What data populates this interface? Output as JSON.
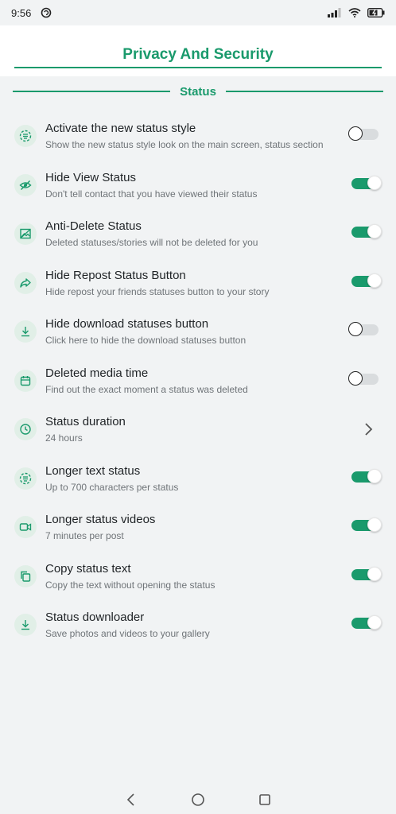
{
  "status_bar": {
    "time": "9:56",
    "battery_level": "charging"
  },
  "header": {
    "title": "Privacy And Security"
  },
  "section": {
    "label": "Status"
  },
  "colors": {
    "accent": "#1a9a6c",
    "icon_bg": "#e1efe7",
    "background": "#f1f3f4"
  },
  "items": [
    {
      "title": "Activate the new status style",
      "subtitle": "Show the new status style look on the main screen, status section",
      "icon": "status-style-icon",
      "control": "toggle",
      "on": false
    },
    {
      "title": "Hide View Status",
      "subtitle": "Don't tell contact that you have viewed their status",
      "icon": "eye-off-icon",
      "control": "toggle",
      "on": true
    },
    {
      "title": "Anti-Delete Status",
      "subtitle": "Deleted statuses/stories will not be deleted for you",
      "icon": "image-icon",
      "control": "toggle",
      "on": true
    },
    {
      "title": "Hide Repost Status Button",
      "subtitle": "Hide repost your friends statuses button to your story",
      "icon": "share-icon",
      "control": "toggle",
      "on": true
    },
    {
      "title": "Hide download statuses button",
      "subtitle": "Click here to hide the download statuses button",
      "icon": "download-icon",
      "control": "toggle",
      "on": false
    },
    {
      "title": "Deleted media time",
      "subtitle": "Find out the exact moment a status was deleted",
      "icon": "calendar-icon",
      "control": "toggle",
      "on": false
    },
    {
      "title": "Status duration",
      "subtitle": "24 hours",
      "icon": "clock-icon",
      "control": "chevron"
    },
    {
      "title": "Longer text status",
      "subtitle": "Up to 700 characters per status",
      "icon": "status-text-icon",
      "control": "toggle",
      "on": true
    },
    {
      "title": "Longer status videos",
      "subtitle": "7 minutes per post",
      "icon": "video-icon",
      "control": "toggle",
      "on": true
    },
    {
      "title": "Copy status text",
      "subtitle": "Copy the text without opening the status",
      "icon": "copy-icon",
      "control": "toggle",
      "on": true
    },
    {
      "title": "Status downloader",
      "subtitle": "Save photos and videos to your gallery",
      "icon": "download-icon",
      "control": "toggle",
      "on": true
    }
  ],
  "nav": {
    "back": "back-icon",
    "home": "home-icon",
    "recents": "recents-icon"
  }
}
